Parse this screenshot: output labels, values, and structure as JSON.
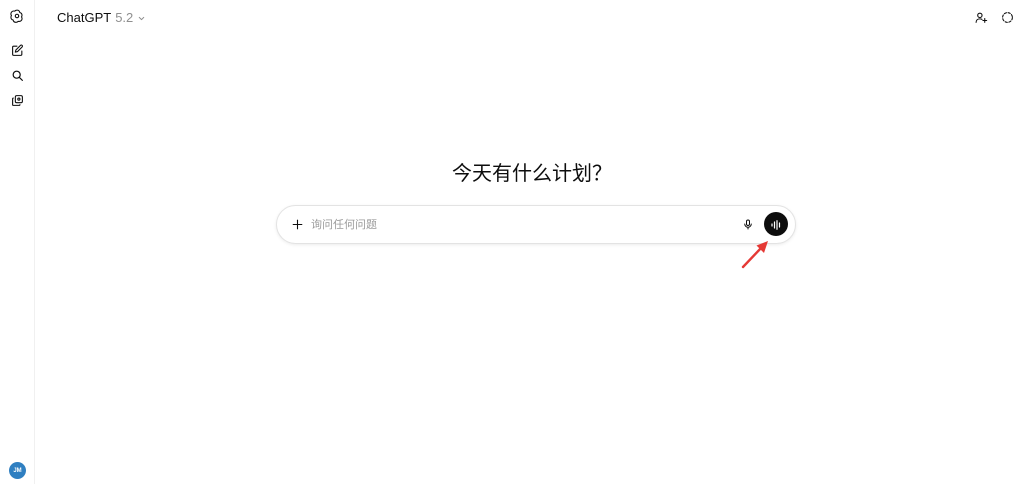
{
  "header": {
    "model_name": "ChatGPT",
    "model_version": "5.2",
    "icons": {
      "logo": "openai-logo-icon",
      "dropdown": "chevron-down-icon",
      "add_people": "add-person-icon",
      "temporary_chat": "dashed-circle-icon"
    }
  },
  "sidebar": {
    "items": [
      {
        "icon": "new-chat-icon"
      },
      {
        "icon": "search-icon"
      },
      {
        "icon": "library-icon"
      }
    ],
    "avatar_initials": "JM",
    "avatar_color": "#2f7fc1"
  },
  "main": {
    "headline": "今天有什么计划？"
  },
  "composer": {
    "placeholder": "询问任何问题",
    "value": "",
    "icons": {
      "attach": "plus-icon",
      "dictate": "microphone-icon",
      "voice_mode": "voice-waveform-icon"
    }
  },
  "annotation": {
    "arrow_color": "#e53935"
  },
  "colors": {
    "text": "#0d0d0d",
    "muted": "#8f8f8f",
    "voice_button": "#0d0d0d",
    "border": "#e3e3e3"
  }
}
